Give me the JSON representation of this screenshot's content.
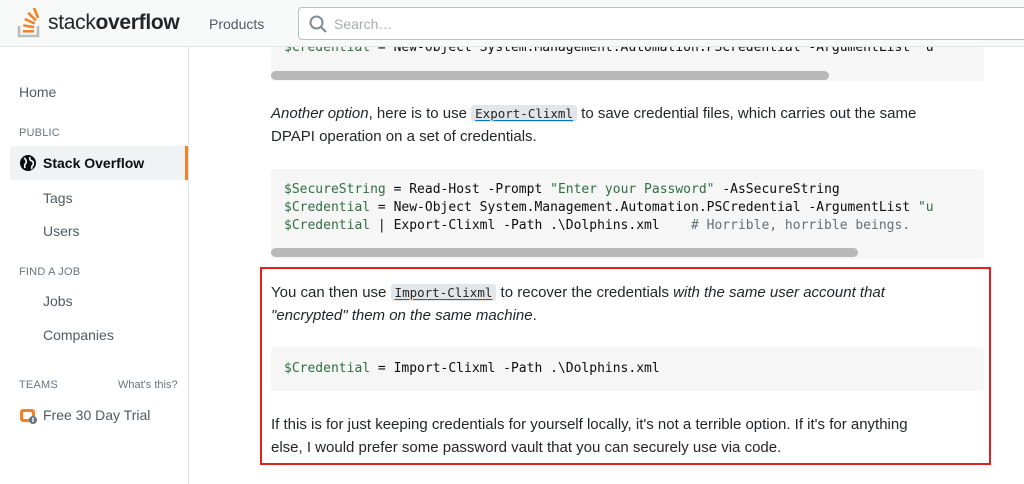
{
  "header": {
    "logo_prefix": "stack",
    "logo_suffix": "overflow",
    "products_label": "Products",
    "search_placeholder": "Search…"
  },
  "sidebar": {
    "home": "Home",
    "public_heading": "PUBLIC",
    "active_item": "Stack Overflow",
    "tags": "Tags",
    "users": "Users",
    "find_job_heading": "FIND A JOB",
    "jobs": "Jobs",
    "companies": "Companies",
    "teams_heading": "TEAMS",
    "whats_this": "What's this?",
    "trial": "Free 30 Day Trial"
  },
  "content": {
    "top_code": {
      "var": "$Credential",
      "rest": " = New-Object System.Management.Automation.PSCredential -ArgumentList \"u"
    },
    "para1": {
      "italic": "Another option",
      "text_a": ", here is to use ",
      "code": "Export-Clixml",
      "text_b": " to save credential files, which carries out the same",
      "line2": "DPAPI operation on a set of credentials."
    },
    "code_block_2": {
      "line1_var": "$SecureString",
      "line1_rest": " = Read-Host -Prompt ",
      "line1_str": "\"Enter your Password\"",
      "line1_tail": " -AsSecureString",
      "line2_var": "$Credential",
      "line2_rest": " = New-Object System.Management.Automation.PSCredential -ArgumentList ",
      "line2_str": "\"u",
      "line3_var": "$Credential",
      "line3_rest": " | Export-Clixml -Path .\\Dolphins.xml    ",
      "line3_cmt": "# Horrible, horrible beings."
    },
    "para2": {
      "text_a": "You can then use ",
      "code": "Import-Clixml",
      "text_b": " to recover the credentials ",
      "italic_a": "with the same user account that",
      "italic_b": "\"encrypted\" them on the same machine",
      "tail": "."
    },
    "code_block_3": {
      "var": "$Credential",
      "rest": " = Import-Clixml -Path .\\Dolphins.xml"
    },
    "para3": {
      "line1": "If this is for just keeping credentials for yourself locally, it's not a terrible option. If it's for anything",
      "line2": "else, I would prefer some password vault that you can securely use via code."
    }
  },
  "colors": {
    "accent": "#f48225",
    "highlight_border": "#e0211c",
    "code_background": "#f6f6f6"
  },
  "icons": [
    "stack-overflow-logo-icon",
    "search-icon",
    "globe-icon",
    "teams-briefcase-icon"
  ]
}
